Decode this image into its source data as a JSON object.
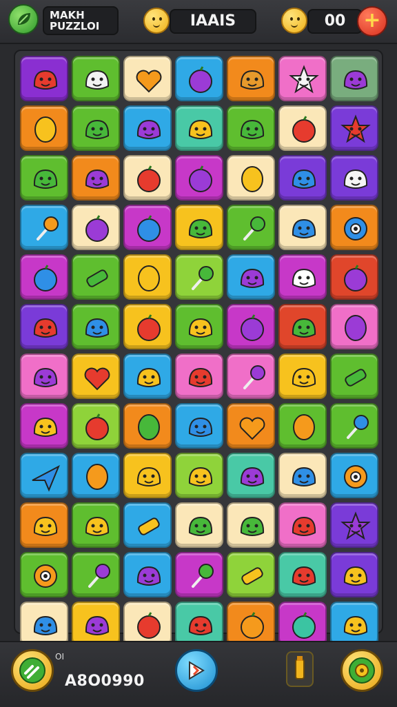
{
  "header": {
    "title_line1": "MAKH",
    "title_line2": "PUZZLOI",
    "center_text": "IAAIS",
    "right_value": "00",
    "plus_label": "+"
  },
  "footer": {
    "small_text": "OI",
    "score": "A8O0990"
  },
  "colors": {
    "purple": "#8a2fd1",
    "green": "#5fbe2f",
    "cream": "#fbe7b8",
    "blue": "#2fa9e6",
    "orange": "#f28a1c",
    "pink": "#f06fc8",
    "sage": "#79ad7e",
    "yellow": "#f7c21e",
    "teal": "#49c9a6",
    "magenta": "#c738c8",
    "red": "#e0462b",
    "lime": "#8fd33a",
    "violet": "#7a3bd8"
  },
  "board": [
    [
      "purple",
      "green",
      "cream",
      "blue",
      "orange",
      "pink",
      "sage"
    ],
    [
      "orange",
      "green",
      "blue",
      "teal",
      "green",
      "cream",
      "violet"
    ],
    [
      "green",
      "orange",
      "cream",
      "magenta",
      "cream",
      "violet",
      "violet"
    ],
    [
      "blue",
      "cream",
      "magenta",
      "yellow",
      "green",
      "cream",
      "orange"
    ],
    [
      "magenta",
      "green",
      "yellow",
      "lime",
      "blue",
      "magenta",
      "red"
    ],
    [
      "violet",
      "green",
      "yellow",
      "green",
      "magenta",
      "red",
      "pink"
    ],
    [
      "pink",
      "yellow",
      "blue",
      "pink",
      "pink",
      "yellow",
      "green"
    ],
    [
      "magenta",
      "lime",
      "orange",
      "blue",
      "orange",
      "green",
      "green"
    ],
    [
      "blue",
      "blue",
      "yellow",
      "lime",
      "teal",
      "cream",
      "blue"
    ],
    [
      "orange",
      "green",
      "blue",
      "cream",
      "cream",
      "pink",
      "violet"
    ],
    [
      "green",
      "green",
      "blue",
      "magenta",
      "lime",
      "teal",
      "violet"
    ],
    [
      "cream",
      "yellow",
      "cream",
      "teal",
      "orange",
      "magenta",
      "blue"
    ]
  ],
  "icons": [
    [
      "red-blob",
      "skull",
      "orange-heart",
      "purple-berry",
      "bell",
      "white-star",
      "purple-blob"
    ],
    [
      "yellow-lemon",
      "green-balloon",
      "purple-blob",
      "yellow-face",
      "green-blob",
      "red-fruit",
      "red-star"
    ],
    [
      "green-blob",
      "purple-blob",
      "red-apple",
      "purple-orb",
      "yellow-lemon",
      "blue-blob",
      "white-ghost"
    ],
    [
      "orange-lollipop",
      "purple-berry",
      "blue-orb",
      "green-turtle",
      "green-lollipop",
      "blue-blob",
      "blue-eye"
    ],
    [
      "blue-berry",
      "green-sticks",
      "yellow-lemon",
      "green-lollipop",
      "purple-squid",
      "spider-bot",
      "purple-berry"
    ],
    [
      "red-blob",
      "blue-balloon",
      "red-berry",
      "yellow-face",
      "purple-orb",
      "green-blob",
      "purple-drop"
    ],
    [
      "purple-blob",
      "red-heart",
      "yellow-face",
      "red-blob",
      "purple-lollipop",
      "yellow-face",
      "green-sticks"
    ],
    [
      "yellow-face",
      "red-apple",
      "green-bean",
      "blue-fish",
      "orange-heart",
      "orange-bean",
      "blue-wand"
    ],
    [
      "blue-plane",
      "orange-drop",
      "yellow-face",
      "yellow-face",
      "purple-blob",
      "blue-blob",
      "orange-eye"
    ],
    [
      "yellow-face",
      "yellow-face",
      "yellow-bone",
      "green-leaf",
      "green-pepper",
      "red-blob",
      "purple-star"
    ],
    [
      "orange-eye",
      "purple-lollipop",
      "purple-blob",
      "green-lollipop",
      "yellow-card",
      "red-bow",
      "yellow-face"
    ],
    [
      "blue-blob",
      "purple-blob",
      "red-apple",
      "red-blob",
      "orange-apple",
      "teal-berry",
      "yellow-face"
    ]
  ]
}
